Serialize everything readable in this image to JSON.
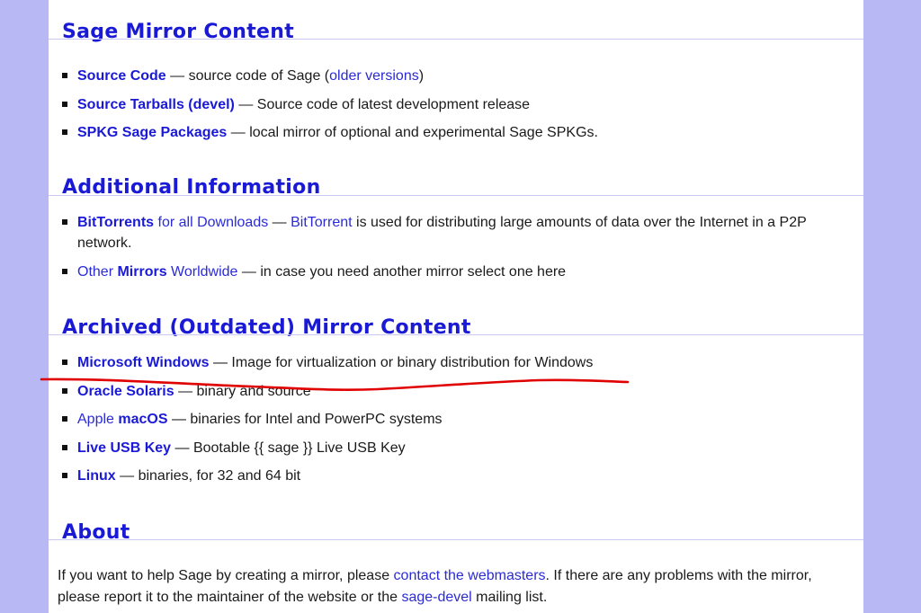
{
  "mirror_content": {
    "heading": "Sage Mirror Content",
    "items": [
      {
        "link": "Source Code",
        "sep": " — ",
        "text": "source code of Sage (",
        "link2": "older versions",
        "text2": ")"
      },
      {
        "link": "Source Tarballs (devel)",
        "sep": " — ",
        "text": "Source code of latest development release"
      },
      {
        "link": "SPKG Sage Packages",
        "sep": " — ",
        "text": "local mirror of optional and experimental Sage SPKGs."
      }
    ]
  },
  "additional_info": {
    "heading": "Additional Information",
    "items": [
      {
        "link_bold": "BitTorrents",
        "link_rest": " for all Downloads",
        "sep": " — ",
        "link2": "BitTorrent",
        "text": " is used for distributing large amounts of data over the Internet in a P2P network."
      },
      {
        "link_pre": "Other ",
        "link_bold": "Mirrors",
        "link_rest": " Worldwide",
        "sep": " — ",
        "text": "in case you need another mirror select one here"
      }
    ]
  },
  "archived": {
    "heading": "Archived (Outdated) Mirror Content",
    "items": [
      {
        "link": "Microsoft Windows",
        "sep": " — ",
        "text": "Image for virtualization or binary distribution for Windows"
      },
      {
        "link": "Oracle Solaris",
        "sep": " — ",
        "text": "binary and source"
      },
      {
        "link_pre": "Apple ",
        "link": "macOS",
        "sep": " — ",
        "text": "binaries for Intel and PowerPC systems"
      },
      {
        "link": "Live USB Key",
        "sep": " — ",
        "text": "Bootable {{ sage }} Live USB Key"
      },
      {
        "link": "Linux",
        "sep": " — ",
        "text": "binaries, for 32 and 64 bit"
      }
    ]
  },
  "about": {
    "heading": "About",
    "text1": "If you want to help Sage by creating a mirror, please ",
    "link1": "contact the webmasters",
    "text2": ". If there are any problems with the mirror, please report it to the maintainer of the website or the ",
    "link2": "sage-devel",
    "text3": " mailing list."
  },
  "colors": {
    "background": "#b8b8f5",
    "heading": "#1a1ad6",
    "link": "#2b2bd6",
    "annotation": "#e00000"
  }
}
